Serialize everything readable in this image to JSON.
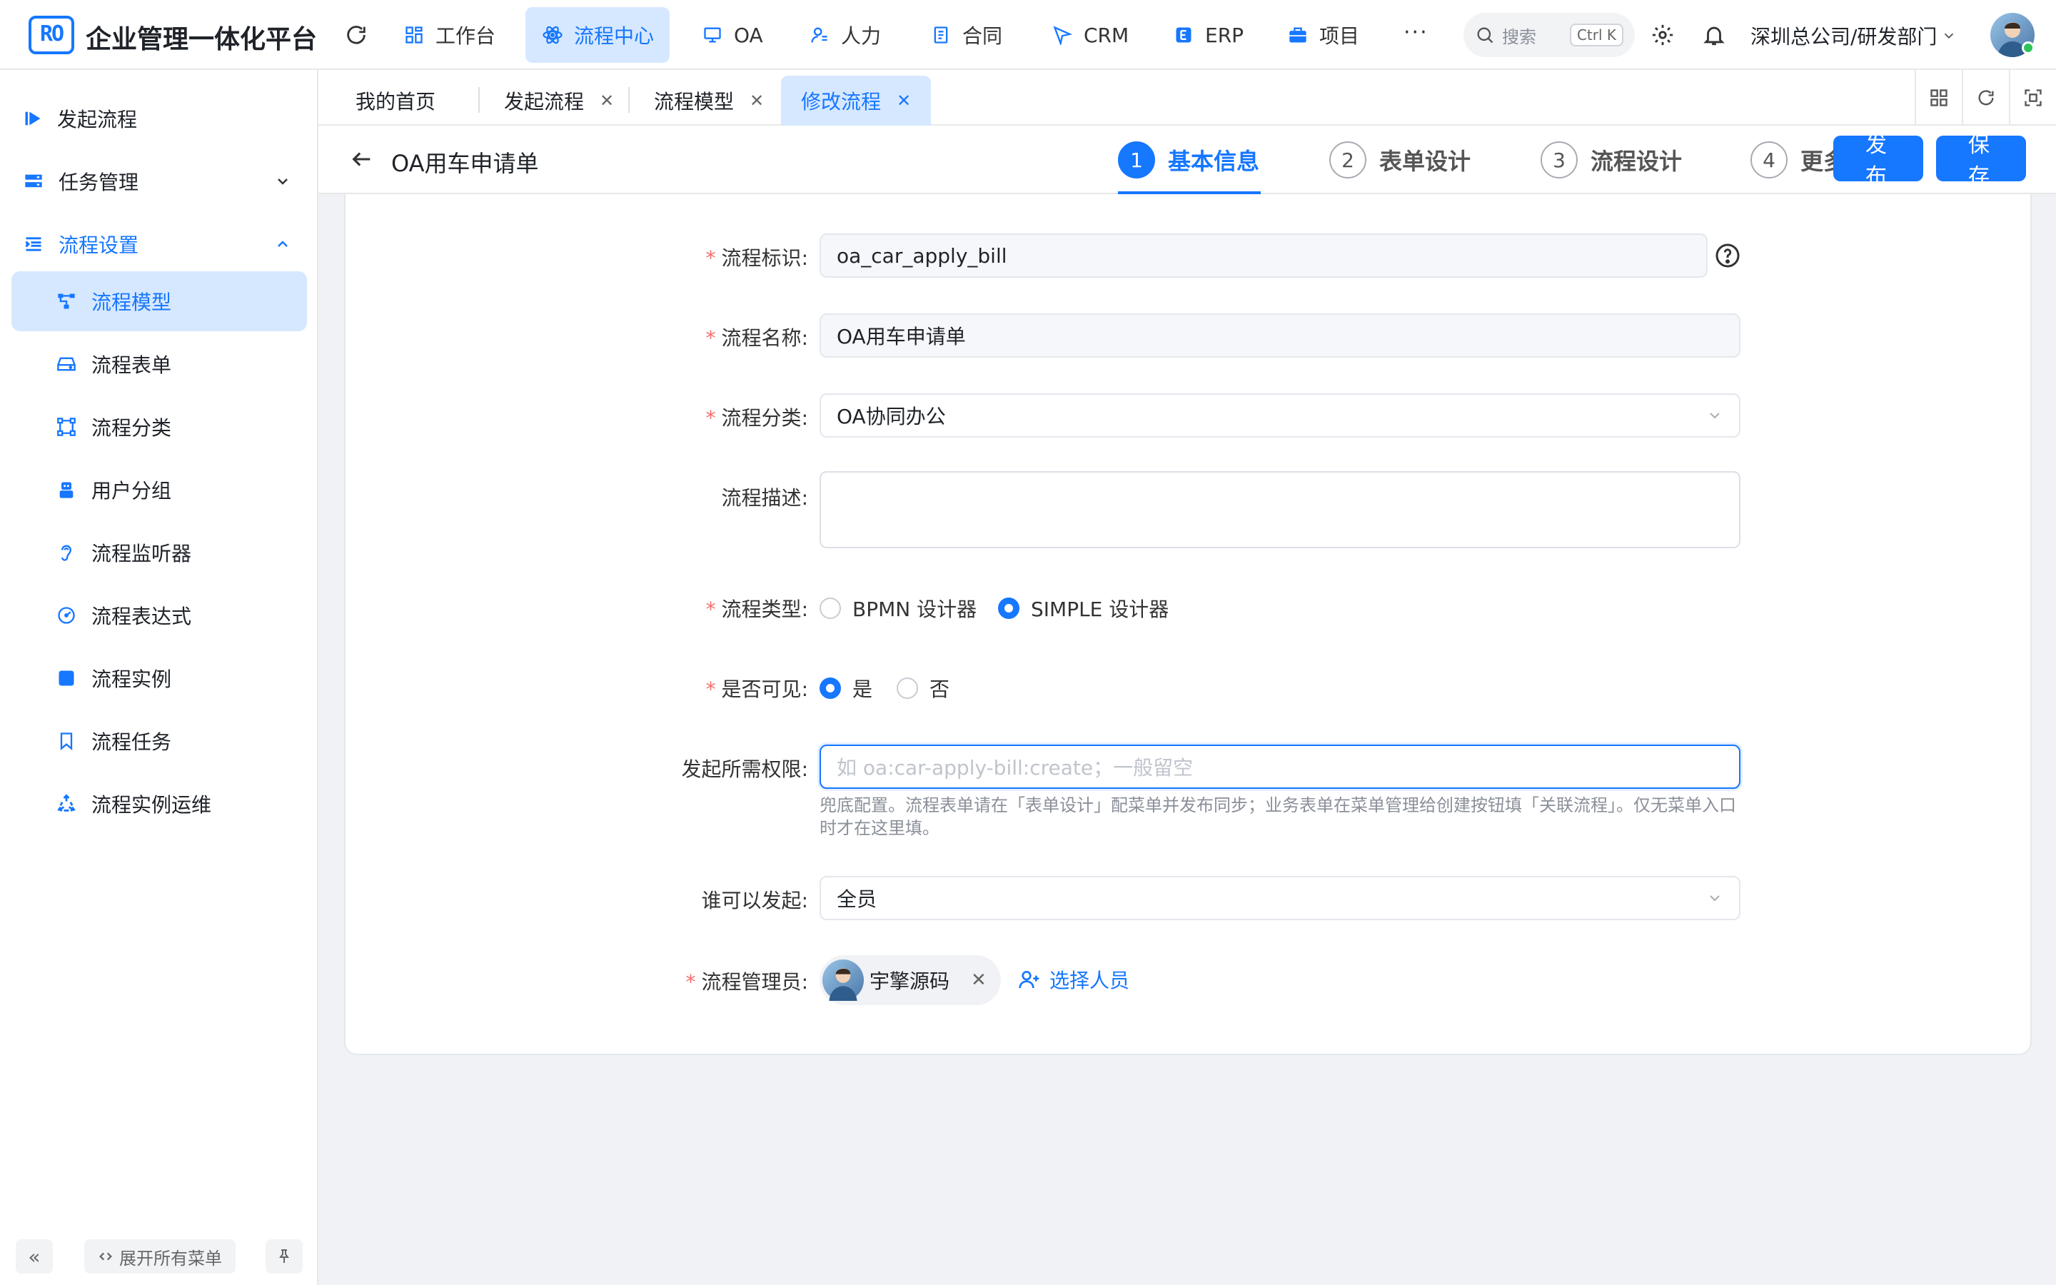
{
  "app": {
    "title": "企业管理一体化平台",
    "logo_text": "RO"
  },
  "topnav": [
    {
      "label": "工作台",
      "icon": "grid-icon"
    },
    {
      "label": "流程中心",
      "icon": "atom-icon",
      "active": true
    },
    {
      "label": "OA",
      "icon": "monitor-icon"
    },
    {
      "label": "人力",
      "icon": "user-icon"
    },
    {
      "label": "合同",
      "icon": "document-icon"
    },
    {
      "label": "CRM",
      "icon": "send-icon"
    },
    {
      "label": "ERP",
      "icon": "erp-icon"
    },
    {
      "label": "项目",
      "icon": "briefcase-icon"
    }
  ],
  "header": {
    "more": "···",
    "search_placeholder": "搜索",
    "search_shortcut": "Ctrl K",
    "org": "深圳总公司/研发部门"
  },
  "sidebar": {
    "items": [
      {
        "label": "发起流程",
        "icon": "play-icon"
      },
      {
        "label": "任务管理",
        "icon": "server-icon"
      },
      {
        "label": "流程设置",
        "icon": "indent-icon"
      },
      {
        "label": "流程模型",
        "icon": "tree-icon",
        "active": true
      },
      {
        "label": "流程表单",
        "icon": "drive-icon"
      },
      {
        "label": "流程分类",
        "icon": "nodes-icon"
      },
      {
        "label": "用户分组",
        "icon": "robot-icon"
      },
      {
        "label": "流程监听器",
        "icon": "ear-icon"
      },
      {
        "label": "流程表达式",
        "icon": "gauge-icon"
      },
      {
        "label": "流程实例",
        "icon": "square-icon"
      },
      {
        "label": "流程任务",
        "icon": "bookmark-icon"
      },
      {
        "label": "流程实例运维",
        "icon": "recycle-icon"
      }
    ],
    "collapse_glyph": "«",
    "expand_all": "展开所有菜单"
  },
  "tabs": [
    {
      "label": "我的首页"
    },
    {
      "label": "发起流程"
    },
    {
      "label": "流程模型"
    },
    {
      "label": "修改流程",
      "active": true
    }
  ],
  "toolbar": {
    "title": "OA用车申请单",
    "steps": [
      {
        "num": "1",
        "label": "基本信息",
        "active": true
      },
      {
        "num": "2",
        "label": "表单设计"
      },
      {
        "num": "3",
        "label": "流程设计"
      },
      {
        "num": "4",
        "label": "更多设置"
      }
    ],
    "publish": "发 布",
    "save": "保 存"
  },
  "form": {
    "key": {
      "label": "流程标识",
      "value": "oa_car_apply_bill"
    },
    "name": {
      "label": "流程名称",
      "value": "OA用车申请单"
    },
    "category": {
      "label": "流程分类",
      "value": "OA协同办公"
    },
    "desc": {
      "label": "流程描述",
      "value": ""
    },
    "type": {
      "label": "流程类型",
      "options": [
        "BPMN 设计器",
        "SIMPLE 设计器"
      ],
      "selected": "SIMPLE 设计器"
    },
    "visible": {
      "label": "是否可见",
      "options": [
        "是",
        "否"
      ],
      "selected": "是"
    },
    "permission": {
      "label": "发起所需权限",
      "placeholder": "如 oa:car-apply-bill:create；一般留空",
      "hint": "兜底配置。流程表单请在「表单设计」配菜单并发布同步；业务表单在菜单管理给创建按钮填「关联流程」。仅无菜单入口时才在这里填。"
    },
    "starter": {
      "label": "谁可以发起",
      "value": "全员"
    },
    "manager": {
      "label": "流程管理员",
      "user": "宇擎源码",
      "pick": "选择人员"
    }
  },
  "colors": {
    "primary": "#1677ff",
    "active_bg": "#d6e8ff",
    "required": "#f56c6c"
  }
}
